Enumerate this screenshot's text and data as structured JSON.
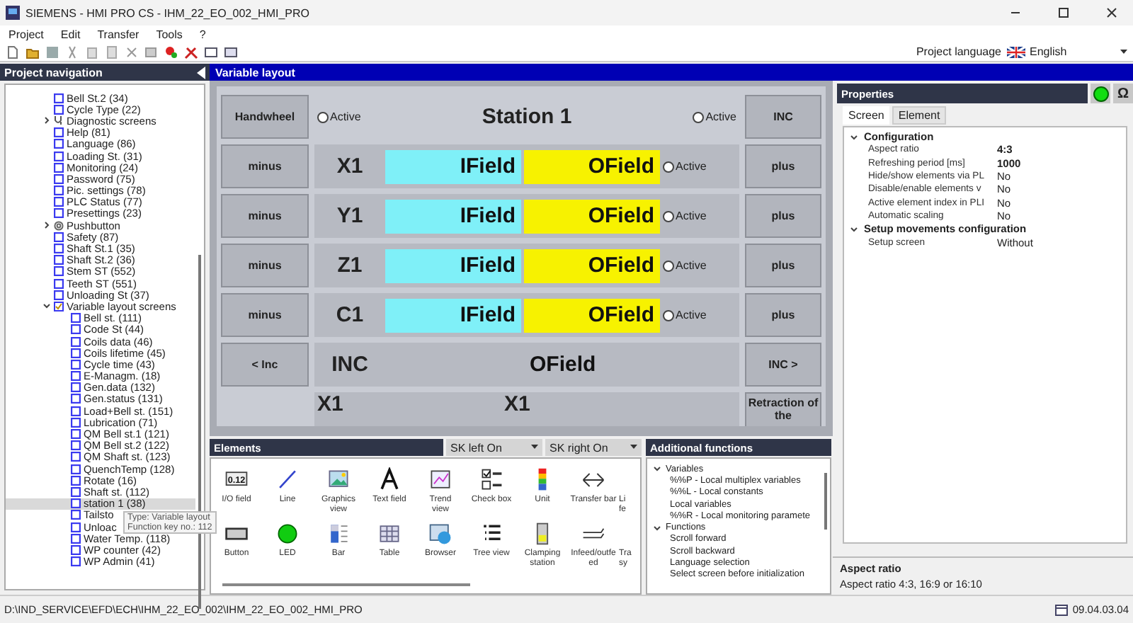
{
  "window": {
    "title": "SIEMENS - HMI PRO CS - IHM_22_EO_002_HMI_PRO"
  },
  "menu": [
    "Project",
    "Edit",
    "Transfer",
    "Tools",
    "?"
  ],
  "project_language": {
    "label": "Project language",
    "value": "English"
  },
  "navigation": {
    "title": "Project navigation",
    "items": [
      {
        "label": "Bell St.2  (34)",
        "kind": "screen",
        "selected": false
      },
      {
        "label": "Cycle Type  (22)",
        "kind": "screen",
        "selected": false
      },
      {
        "label": "Diagnostic screens",
        "kind": "diagnostic",
        "expanded": false,
        "selected": false
      },
      {
        "label": "Help  (81)",
        "kind": "screen",
        "selected": false
      },
      {
        "label": "Language  (86)",
        "kind": "screen",
        "selected": false
      },
      {
        "label": "Loading St.  (31)",
        "kind": "screen",
        "selected": false
      },
      {
        "label": "Monitoring  (24)",
        "kind": "screen",
        "selected": false
      },
      {
        "label": "Password  (75)",
        "kind": "screen",
        "selected": false
      },
      {
        "label": "Pic. settings  (78)",
        "kind": "screen",
        "selected": false
      },
      {
        "label": "PLC Status  (77)",
        "kind": "screen",
        "selected": false
      },
      {
        "label": "Presettings  (23)",
        "kind": "screen",
        "selected": false
      },
      {
        "label": "Pushbutton",
        "kind": "pushbutton",
        "expanded": false,
        "selected": false
      },
      {
        "label": "Safety  (87)",
        "kind": "screen",
        "selected": false
      },
      {
        "label": "Shaft St.1  (35)",
        "kind": "screen",
        "selected": false
      },
      {
        "label": "Shaft St.2  (36)",
        "kind": "screen",
        "selected": false
      },
      {
        "label": "Stem ST  (552)",
        "kind": "screen",
        "selected": false
      },
      {
        "label": "Teeth ST  (551)",
        "kind": "screen",
        "selected": false
      },
      {
        "label": "Unloading St  (37)",
        "kind": "screen",
        "selected": false
      },
      {
        "label": "Variable layout screens",
        "kind": "variable",
        "expanded": true,
        "selected": false,
        "children": [
          {
            "label": "Bell st.  (111)",
            "kind": "screen",
            "selected": false
          },
          {
            "label": "Code St  (44)",
            "kind": "screen",
            "selected": false
          },
          {
            "label": "Coils data  (46)",
            "kind": "screen",
            "selected": false
          },
          {
            "label": "Coils lifetime  (45)",
            "kind": "screen",
            "selected": false
          },
          {
            "label": "Cycle time  (43)",
            "kind": "screen",
            "selected": false
          },
          {
            "label": "E-Managm.  (18)",
            "kind": "screen",
            "selected": false
          },
          {
            "label": "Gen.data  (132)",
            "kind": "screen",
            "selected": false
          },
          {
            "label": "Gen.status  (131)",
            "kind": "screen",
            "selected": false
          },
          {
            "label": "Load+Bell st.  (151)",
            "kind": "screen",
            "selected": false
          },
          {
            "label": "Lubrication  (71)",
            "kind": "screen",
            "selected": false
          },
          {
            "label": "QM Bell st.1  (121)",
            "kind": "screen",
            "selected": false
          },
          {
            "label": "QM Bell st.2  (122)",
            "kind": "screen",
            "selected": false
          },
          {
            "label": "QM Shaft st.  (123)",
            "kind": "screen",
            "selected": false
          },
          {
            "label": "QuenchTemp  (128)",
            "kind": "screen",
            "selected": false
          },
          {
            "label": "Rotate  (16)",
            "kind": "screen",
            "selected": false
          },
          {
            "label": "Shaft st.  (112)",
            "kind": "screen",
            "selected": false
          },
          {
            "label": "station 1  (38)",
            "kind": "screen",
            "selected": true
          },
          {
            "label": "Tailsto",
            "kind": "screen",
            "selected": false
          },
          {
            "label": "Unloac",
            "kind": "screen",
            "selected": false
          },
          {
            "label": "Water Temp.  (118)",
            "kind": "screen",
            "selected": false
          },
          {
            "label": "WP counter  (42)",
            "kind": "screen",
            "selected": false
          },
          {
            "label": "WP Admin  (41)",
            "kind": "screen",
            "selected": false
          }
        ]
      }
    ],
    "tooltip": [
      "Type: Variable layout",
      "Function key no.: 112"
    ]
  },
  "editor": {
    "title": "Variable layout",
    "screen": {
      "title": "Station 1",
      "title_radios": [
        {
          "label": "Active",
          "checked": false
        },
        {
          "label": "Active",
          "checked": false
        }
      ],
      "left_buttons": [
        "Handwheel",
        "minus",
        "minus",
        "minus",
        "minus",
        "< Inc"
      ],
      "right_buttons": [
        "INC",
        "plus",
        "plus",
        "plus",
        "plus",
        "INC >",
        "Retraction of the"
      ],
      "rows": [
        {
          "axis": "X1",
          "input": "IField",
          "output": "OField",
          "radio": {
            "label": "Active",
            "checked": false
          }
        },
        {
          "axis": "Y1",
          "input": "IField",
          "output": "OField",
          "radio": {
            "label": "Active",
            "checked": false
          }
        },
        {
          "axis": "Z1",
          "input": "IField",
          "output": "OField",
          "radio": {
            "label": "Active",
            "checked": false
          }
        },
        {
          "axis": "C1",
          "input": "IField",
          "output": "OField",
          "radio": {
            "label": "Active",
            "checked": false
          }
        }
      ],
      "inc_row": {
        "label": "INC",
        "output": "OField"
      },
      "bottom_row": [
        "X1",
        "X1"
      ]
    }
  },
  "elements": {
    "title": "Elements",
    "softkeys": [
      "SK left On",
      "SK right On"
    ],
    "items": [
      [
        "I/O field"
      ],
      [
        "Line"
      ],
      [
        "Graphics",
        "view"
      ],
      [
        "Text field"
      ],
      [
        "Trend",
        "view"
      ],
      [
        "Check box"
      ],
      [
        "Unit"
      ],
      [
        "Transfer bar"
      ],
      [
        "Li",
        "fe"
      ],
      [
        "Button"
      ],
      [
        "LED"
      ],
      [
        "Bar"
      ],
      [
        "Table"
      ],
      [
        "Browser"
      ],
      [
        "Tree view"
      ],
      [
        "Clamping",
        "station"
      ],
      [
        "Infeed/outfe",
        "ed"
      ],
      [
        "Tra",
        "sy"
      ]
    ],
    "icon_text": "0.12"
  },
  "additional_functions": {
    "title": "Additional functions",
    "groups": [
      {
        "label": "Variables",
        "expanded": true,
        "children": [
          "%%P - Local multiplex variables",
          "%%L - Local constants",
          "Local variables",
          "%%R - Local monitoring paramete"
        ]
      },
      {
        "label": "Functions",
        "expanded": true,
        "children": [
          "Scroll forward",
          "Scroll backward",
          "Language selection",
          "Select screen before initialization"
        ]
      }
    ]
  },
  "properties": {
    "title": "Properties",
    "status_on": true,
    "omega": "Ω",
    "tabs": [
      {
        "label": "Screen",
        "selected": true
      },
      {
        "label": "Element",
        "selected": false
      }
    ],
    "groups": [
      {
        "label": "Configuration",
        "expanded": true,
        "rows": [
          {
            "name": "Aspect ratio",
            "value": "4:3",
            "modified": true
          },
          {
            "name": "Refreshing period [ms]",
            "value": "1000",
            "modified": true
          },
          {
            "name": "Hide/show elements via PL",
            "value": "No",
            "modified": false
          },
          {
            "name": "Disable/enable elements v",
            "value": "No",
            "modified": false
          },
          {
            "name": "Active element index in PLI",
            "value": "No",
            "modified": false
          },
          {
            "name": "Automatic scaling",
            "value": "No",
            "modified": false
          }
        ]
      },
      {
        "label": "Setup movements configuration",
        "expanded": true,
        "rows": [
          {
            "name": "Setup screen",
            "value": "Without",
            "modified": false
          }
        ]
      }
    ],
    "help_title": "Aspect ratio",
    "help_text": "Aspect ratio 4:3, 16:9 or 16:10"
  },
  "status_bar": {
    "path": "D:\\IND_SERVICE\\EFD\\ECH\\IHM_22_EO_002\\IHM_22_EO_002_HMI_PRO",
    "date": "09.04.03.04"
  }
}
